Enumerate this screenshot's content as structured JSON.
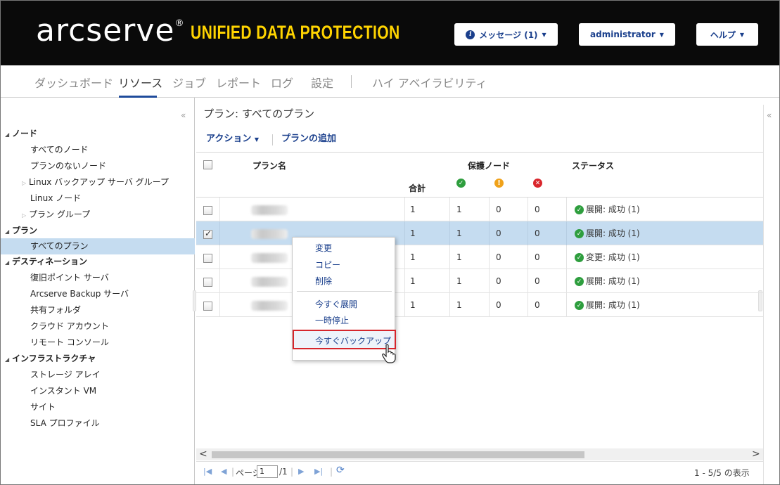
{
  "header": {
    "logo": "arcserve",
    "logo_reg": "®",
    "subtitle": "UNIFIED DATA PROTECTION",
    "messages_label": "メッセージ (1)",
    "user_label": "administrator",
    "help_label": "ヘルプ"
  },
  "nav": {
    "items": [
      "ダッシュボード",
      "リソース",
      "ジョブ",
      "レポート",
      "ログ",
      "設定",
      "ハイ アベイラビリティ"
    ],
    "active": "リソース"
  },
  "sidebar": {
    "collapse": "«",
    "items": [
      {
        "label": "ノード",
        "type": "header",
        "expander": "◢"
      },
      {
        "label": "すべてのノード",
        "type": "leaf"
      },
      {
        "label": "プランのないノード",
        "type": "leaf"
      },
      {
        "label": "Linux バックアップ サーバ グループ",
        "type": "branch",
        "expander": "▷"
      },
      {
        "label": "Linux ノード",
        "type": "leaf"
      },
      {
        "label": "プラン グループ",
        "type": "branch",
        "expander": "▷"
      },
      {
        "label": "プラン",
        "type": "header",
        "expander": "◢"
      },
      {
        "label": "すべてのプラン",
        "type": "leaf",
        "selected": true
      },
      {
        "label": "デスティネーション",
        "type": "header",
        "expander": "◢"
      },
      {
        "label": "復旧ポイント サーバ",
        "type": "leaf"
      },
      {
        "label": "Arcserve Backup サーバ",
        "type": "leaf"
      },
      {
        "label": "共有フォルダ",
        "type": "leaf"
      },
      {
        "label": "クラウド アカウント",
        "type": "leaf"
      },
      {
        "label": "リモート コンソール",
        "type": "leaf"
      },
      {
        "label": "インフラストラクチャ",
        "type": "header",
        "expander": "◢"
      },
      {
        "label": "ストレージ アレイ",
        "type": "leaf"
      },
      {
        "label": "インスタント VM",
        "type": "leaf"
      },
      {
        "label": "サイト",
        "type": "leaf"
      },
      {
        "label": "SLA プロファイル",
        "type": "leaf"
      }
    ]
  },
  "main": {
    "title": "プラン: すべてのプラン",
    "collapse_right": "«",
    "toolbar": {
      "action_label": "アクション",
      "add_plan_label": "プランの追加"
    },
    "columns": {
      "plan_name": "プラン名",
      "protected_nodes": "保護ノード",
      "status": "ステータス",
      "total": "合計"
    },
    "rows": [
      {
        "total": "1",
        "ok": "1",
        "warn": "0",
        "err": "0",
        "status": "展開: 成功 (1)",
        "checked": false,
        "selected": false
      },
      {
        "total": "1",
        "ok": "1",
        "warn": "0",
        "err": "0",
        "status": "展開: 成功 (1)",
        "checked": true,
        "selected": true
      },
      {
        "total": "1",
        "ok": "1",
        "warn": "0",
        "err": "0",
        "status": "変更: 成功 (1)",
        "checked": false,
        "selected": false
      },
      {
        "total": "1",
        "ok": "1",
        "warn": "0",
        "err": "0",
        "status": "展開: 成功 (1)",
        "checked": false,
        "selected": false
      },
      {
        "total": "1",
        "ok": "1",
        "warn": "0",
        "err": "0",
        "status": "展開: 成功 (1)",
        "checked": false,
        "selected": false
      }
    ],
    "context_menu": {
      "edit": "変更",
      "copy": "コピー",
      "delete": "削除",
      "deploy_now": "今すぐ展開",
      "pause": "一時停止",
      "backup_now": "今すぐバックアップ"
    },
    "paging": {
      "page_label": "ページ",
      "page_value": "1",
      "of_total": "/1",
      "summary": "1 - 5/5 の表示"
    }
  },
  "colors": {
    "accent": "#1a3f8c",
    "logo_sub": "#ffd400",
    "selection": "#c5dcf0",
    "ok": "#2e9e3e",
    "warn": "#f0a21a",
    "error": "#d9262c",
    "highlight_border": "#d6262c"
  }
}
